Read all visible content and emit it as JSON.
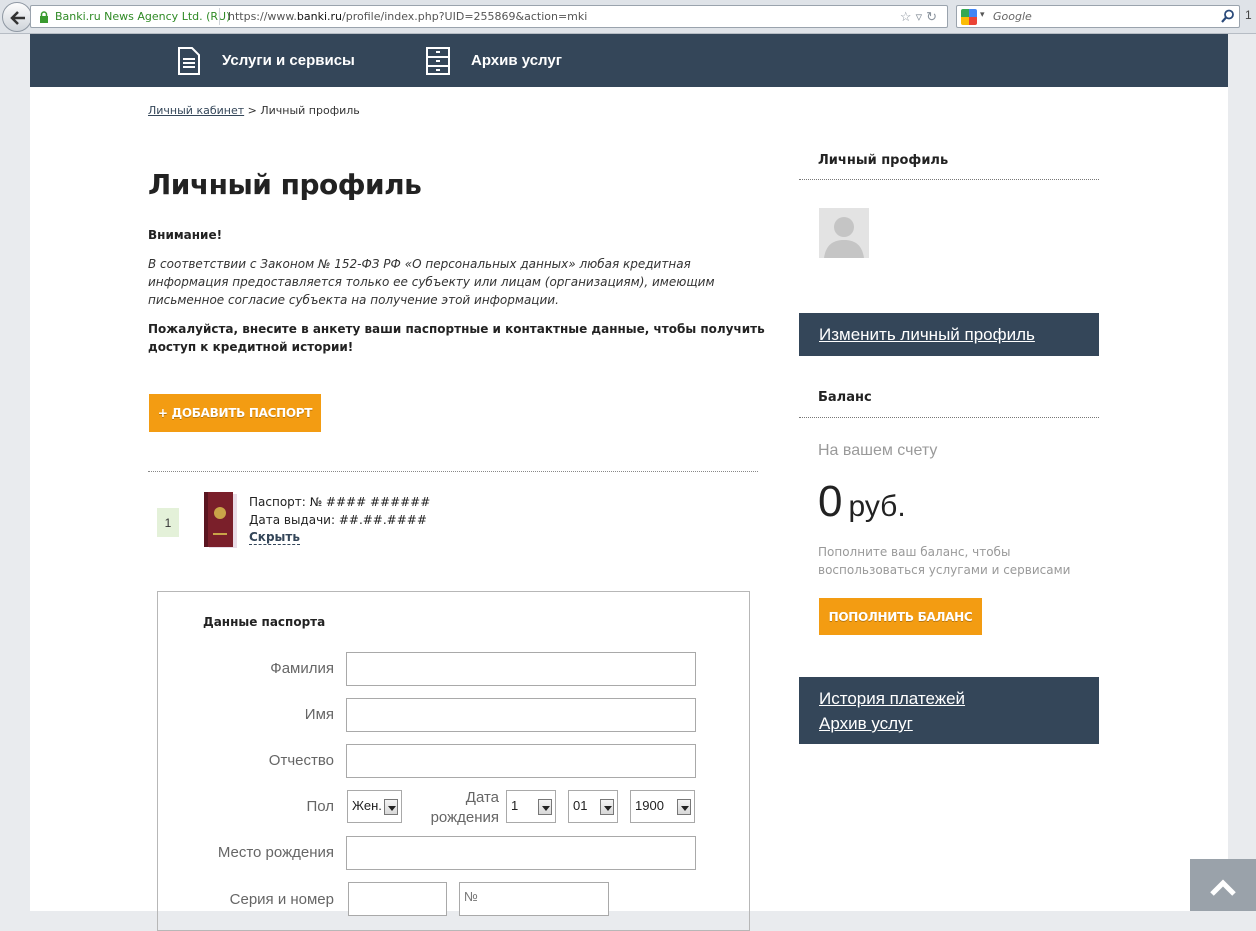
{
  "browser": {
    "site_identity": "Banki.ru News Agency Ltd. (RU)",
    "url_prefix": "https://www.",
    "url_domain": "banki.ru",
    "url_path": "/profile/index.php?UID=255869&action=mki",
    "search_placeholder": "Google",
    "edge_char": "1"
  },
  "topnav": {
    "items": [
      {
        "label": "Услуги и сервисы",
        "icon": "document-icon"
      },
      {
        "label": "Архив услуг",
        "icon": "cabinet-icon"
      }
    ]
  },
  "breadcrumb": {
    "link": "Личный кабинет",
    "separator": " > ",
    "current": "Личный профиль"
  },
  "main": {
    "title": "Личный профиль",
    "attention": "Внимание!",
    "law_text": "В соответствии с Законом № 152-ФЗ РФ «О персональных данных» любая кредитная информация предоставляется только ее субъекту или лицам (организациям), имеющим письменное согласие субъекта на получение этой информации.",
    "please_text": "Пожалуйста, внесите в анкету ваши паспортные и контактные данные, чтобы получить доступ к кредитной истории!",
    "add_passport_button": "+ ДОБАВИТЬ ПАСПОРТ"
  },
  "passport": {
    "index": "1",
    "number_line": "Паспорт: № #### ######",
    "issue_line": "Дата выдачи: ##.##.####",
    "hide_link": "Скрыть"
  },
  "form": {
    "title": "Данные паспорта",
    "labels": {
      "last_name": "Фамилия",
      "first_name": "Имя",
      "patronymic": "Отчество",
      "gender": "Пол",
      "birth_date_1": "Дата",
      "birth_date_2": "рождения",
      "birth_place": "Место рождения",
      "series_number": "Серия и номер"
    },
    "values": {
      "gender": "Жен.",
      "day": "1",
      "month": "01",
      "year": "1900",
      "number_placeholder": "№"
    }
  },
  "sidebar": {
    "profile_heading": "Личный профиль",
    "edit_profile_link": "Изменить личный профиль",
    "balance_heading": "Баланс",
    "balance_label": "На вашем счету",
    "balance_amount": "0",
    "balance_currency": "руб.",
    "balance_hint": "Пополните ваш баланс, чтобы воспользоваться услугами и сервисами",
    "topup_button": "ПОПОЛНИТЬ БАЛАНС",
    "history_link": "История платежей",
    "archive_link": "Архив услуг"
  },
  "colors": {
    "nav_bg": "#344659",
    "accent_orange": "#f39c12",
    "passport_index_bg": "#e4f1d9"
  }
}
